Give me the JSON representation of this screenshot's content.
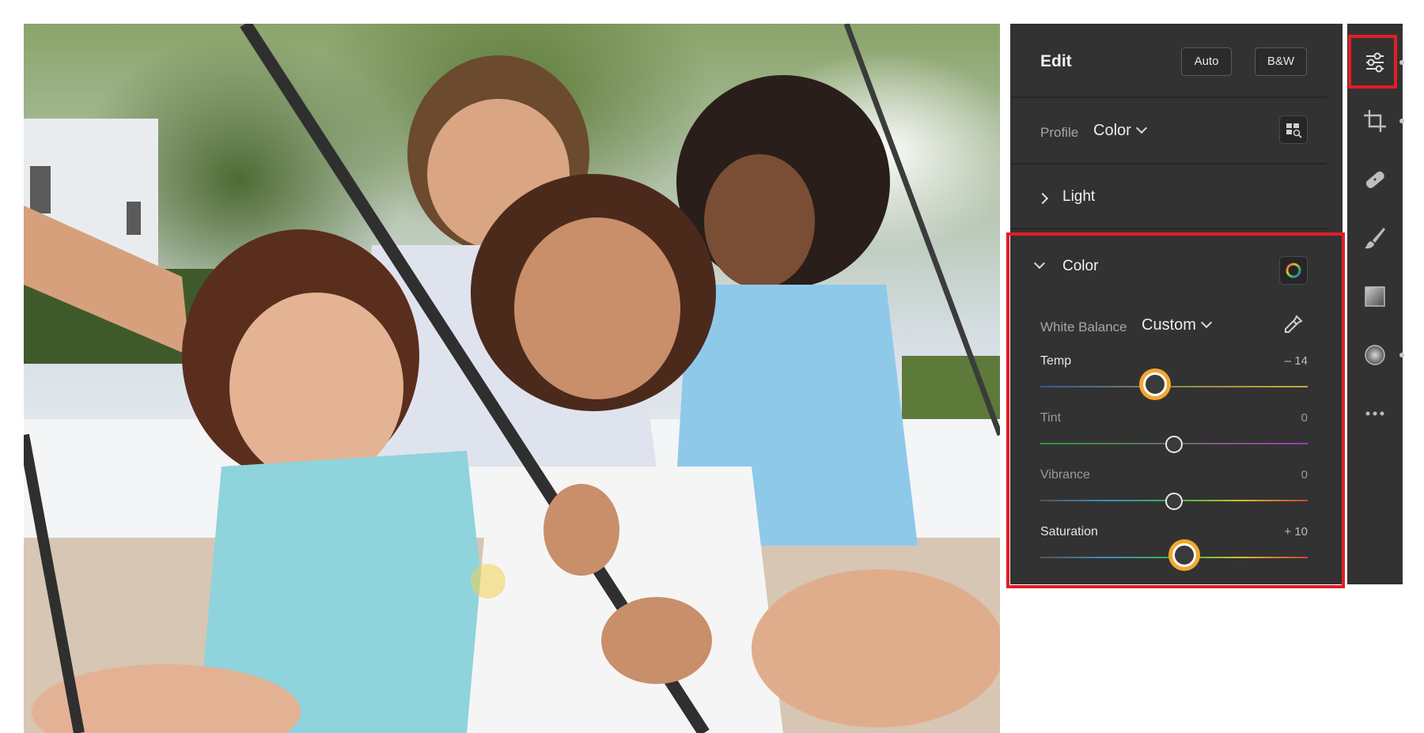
{
  "edit_panel": {
    "title": "Edit",
    "auto_label": "Auto",
    "bw_label": "B&W",
    "profile_label": "Profile",
    "profile_value": "Color",
    "light_section": "Light",
    "color_section": "Color",
    "white_balance_label": "White Balance",
    "white_balance_value": "Custom",
    "sliders": [
      {
        "label": "Temp",
        "value": "– 14",
        "position": 0.44,
        "active": true,
        "track": "linear-gradient(90deg,#2f5a9e,#8a8a4a,#c9a83a)"
      },
      {
        "label": "Tint",
        "value": "0",
        "position": 0.5,
        "active": false,
        "track": "linear-gradient(90deg,#2f9a3a,#6a6a6a,#a038b8)"
      },
      {
        "label": "Vibrance",
        "value": "0",
        "position": 0.5,
        "active": false,
        "track": "linear-gradient(90deg,#555,#3a8fc0,#3ab04a,#d0c030,#d04030)"
      },
      {
        "label": "Saturation",
        "value": "+ 10",
        "position": 0.55,
        "active": true,
        "track": "linear-gradient(90deg,#555,#3a8fc0,#3ab04a,#d0c030,#d04030)"
      }
    ]
  },
  "tool_strip": {
    "tools": [
      "sliders-icon",
      "crop-icon",
      "healing-bandage-icon",
      "brush-icon",
      "linear-gradient-icon",
      "radial-gradient-icon",
      "more-icon"
    ]
  },
  "colors": {
    "highlight": "#e21d26",
    "active_knob_ring": "#f2a830",
    "panel_bg": "#323232"
  }
}
